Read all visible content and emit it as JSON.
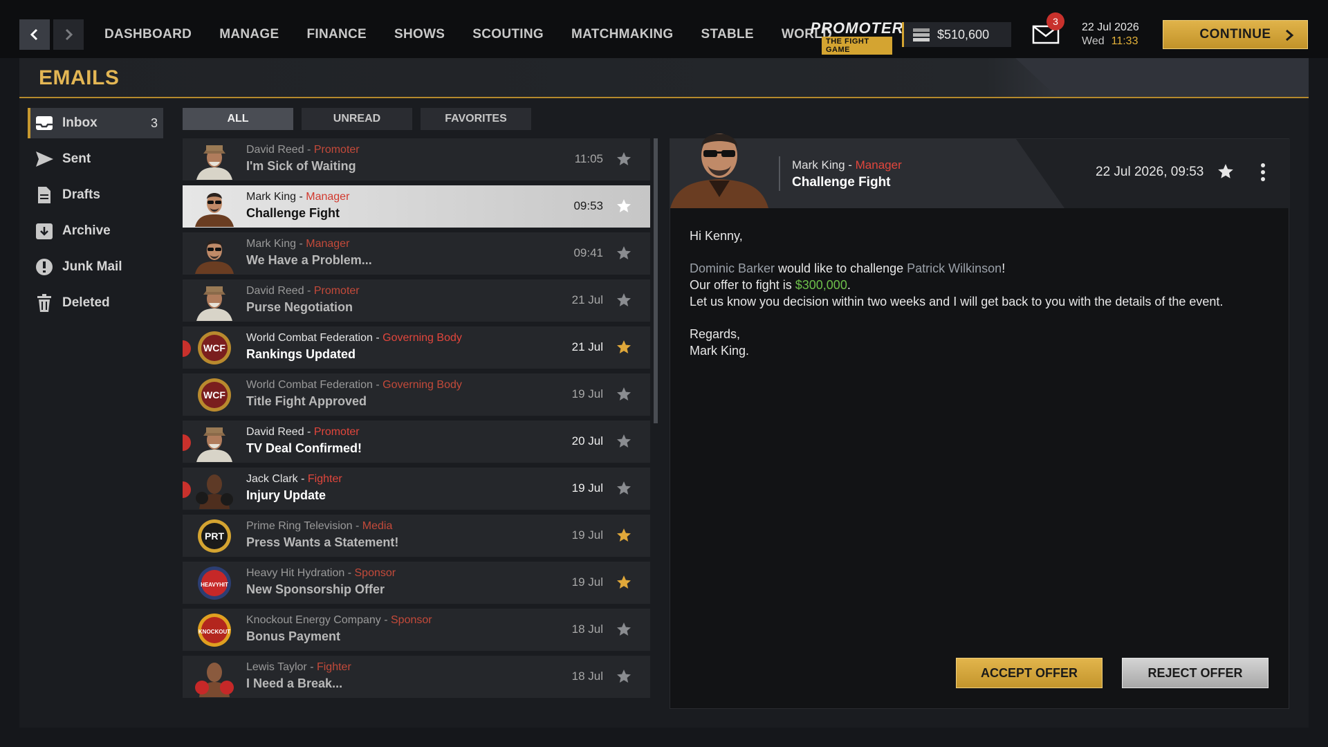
{
  "nav": {
    "menu": [
      "DASHBOARD",
      "MANAGE",
      "FINANCE",
      "SHOWS",
      "SCOUTING",
      "MATCHMAKING",
      "STABLE",
      "WORLD"
    ],
    "logo_title": "PROMOTER",
    "logo_subtitle": "THE FIGHT GAME",
    "money": "$510,600",
    "mail_count": "3",
    "date": "22 Jul 2026",
    "weekday": "Wed",
    "time": "11:33",
    "continue_label": "CONTINUE"
  },
  "page": {
    "title": "EMAILS"
  },
  "sidebar": {
    "items": [
      {
        "label": "Inbox",
        "count": "3",
        "icon": "inbox-icon",
        "active": true
      },
      {
        "label": "Sent",
        "count": "",
        "icon": "send-icon",
        "active": false
      },
      {
        "label": "Drafts",
        "count": "",
        "icon": "drafts-icon",
        "active": false
      },
      {
        "label": "Archive",
        "count": "",
        "icon": "archive-icon",
        "active": false
      },
      {
        "label": "Junk Mail",
        "count": "",
        "icon": "junk-icon",
        "active": false
      },
      {
        "label": "Deleted",
        "count": "",
        "icon": "trash-icon",
        "active": false
      }
    ]
  },
  "tabs": [
    {
      "label": "ALL",
      "active": true
    },
    {
      "label": "UNREAD",
      "active": false
    },
    {
      "label": "FAVORITES",
      "active": false
    }
  ],
  "emails": [
    {
      "sender": "David Reed",
      "role": "Promoter",
      "subject": "I'm Sick of Waiting",
      "date": "11:05",
      "favorite": false,
      "unread": false,
      "selected": false,
      "avatar": "david-reed"
    },
    {
      "sender": "Mark King",
      "role": "Manager",
      "subject": "Challenge Fight",
      "date": "09:53",
      "favorite": false,
      "unread": false,
      "selected": true,
      "avatar": "mark-king"
    },
    {
      "sender": "Mark King",
      "role": "Manager",
      "subject": "We Have a Problem...",
      "date": "09:41",
      "favorite": false,
      "unread": false,
      "selected": false,
      "avatar": "mark-king"
    },
    {
      "sender": "David Reed",
      "role": "Promoter",
      "subject": "Purse Negotiation",
      "date": "21 Jul",
      "favorite": false,
      "unread": false,
      "selected": false,
      "avatar": "david-reed"
    },
    {
      "sender": "World Combat Federation",
      "role": "Governing Body",
      "subject": "Rankings Updated",
      "date": "21 Jul",
      "favorite": true,
      "unread": true,
      "selected": false,
      "avatar": "wcf"
    },
    {
      "sender": "World Combat Federation",
      "role": "Governing Body",
      "subject": "Title Fight Approved",
      "date": "19 Jul",
      "favorite": false,
      "unread": false,
      "selected": false,
      "avatar": "wcf"
    },
    {
      "sender": "David Reed",
      "role": "Promoter",
      "subject": "TV Deal Confirmed!",
      "date": "20 Jul",
      "favorite": false,
      "unread": true,
      "selected": false,
      "avatar": "david-reed"
    },
    {
      "sender": "Jack Clark",
      "role": "Fighter",
      "subject": "Injury Update",
      "date": "19 Jul",
      "favorite": false,
      "unread": true,
      "selected": false,
      "avatar": "jack-clark"
    },
    {
      "sender": "Prime Ring Television",
      "role": "Media",
      "subject": "Press Wants a Statement!",
      "date": "19 Jul",
      "favorite": true,
      "unread": false,
      "selected": false,
      "avatar": "prt"
    },
    {
      "sender": "Heavy Hit Hydration",
      "role": "Sponsor",
      "subject": "New Sponsorship Offer",
      "date": "19 Jul",
      "favorite": true,
      "unread": false,
      "selected": false,
      "avatar": "heavyhit"
    },
    {
      "sender": "Knockout Energy Company",
      "role": "Sponsor",
      "subject": "Bonus Payment",
      "date": "18 Jul",
      "favorite": false,
      "unread": false,
      "selected": false,
      "avatar": "knockout"
    },
    {
      "sender": "Lewis Taylor",
      "role": "Fighter",
      "subject": "I Need a Break...",
      "date": "18 Jul",
      "favorite": false,
      "unread": false,
      "selected": false,
      "avatar": "lewis-taylor"
    }
  ],
  "logos": {
    "wcf": "WCF",
    "prt": "PRT",
    "heavyhit": "HEAVYHIT",
    "knockout": "KNOCKOUT"
  },
  "reader": {
    "sender": "Mark King",
    "role": "Manager",
    "subject": "Challenge Fight",
    "datetime": "22 Jul 2026, 09:53",
    "greeting": "Hi Kenny,",
    "challenger": "Dominic Barker",
    "line1_mid": " would like to challenge ",
    "opponent": "Patrick Wilkinson",
    "line1_end": "!",
    "line2_pre": "Our offer to fight is ",
    "offer": "$300,000",
    "line2_end": ".",
    "line3": "Let us know you decision within two weeks and I will get back to you with the details of the event.",
    "regards": "Regards,",
    "signature": "Mark King.",
    "accept_label": "ACCEPT OFFER",
    "reject_label": "REJECT OFFER"
  },
  "colors": {
    "accent_gold": "#d4a431",
    "role_red": "#e2463c",
    "offer_green": "#6dc04a",
    "unread_dot": "#c9312c",
    "star_favorite": "#e0a83a",
    "star_default": "#8a8c90"
  }
}
